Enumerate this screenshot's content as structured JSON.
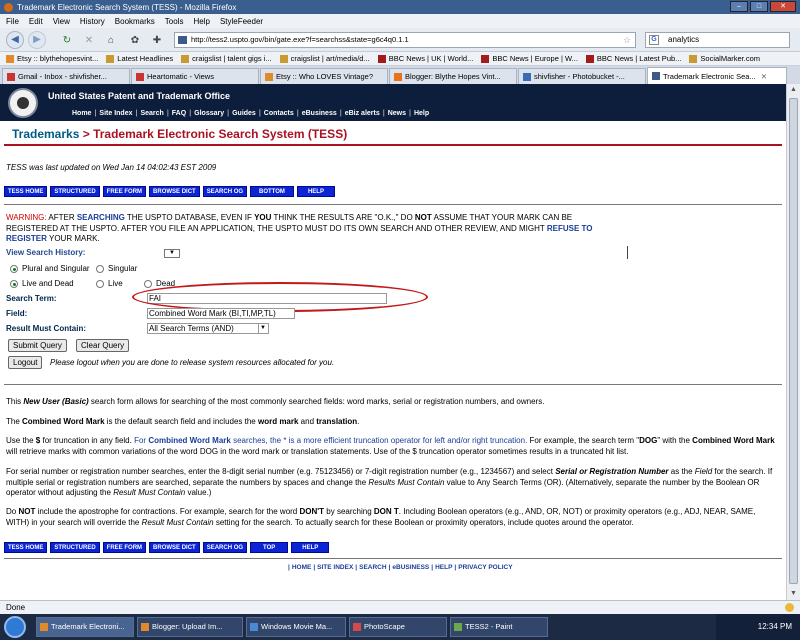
{
  "window": {
    "title": "Trademark Electronic Search System (TESS) - Mozilla Firefox"
  },
  "menu": [
    "File",
    "Edit",
    "View",
    "History",
    "Bookmarks",
    "Tools",
    "Help",
    "StyleFeeder"
  ],
  "nav": {
    "url": "http://tess2.uspto.gov/bin/gate.exe?f=searchss&state=g6c4q0.1.1",
    "search_value": "analytics"
  },
  "bookmarks": [
    "Etsy :: blythehopesvint...",
    "Latest Headlines",
    "craigslist | talent gigs i...",
    "craigslist | art/media/d...",
    "BBC News | UK | World...",
    "BBC News | Europe | W...",
    "BBC News | Latest Pub...",
    "SocialMarker.com"
  ],
  "tabs": [
    "Gmail - Inbox - shivfisher...",
    "Heartomatic - Views",
    "Etsy :: Who LOVES Vintage?",
    "Blogger: Blythe Hopes Vint...",
    "shivfisher - Photobucket -...",
    "Trademark Electronic Sea..."
  ],
  "banner": {
    "title": "United States Patent and Trademark Office",
    "links": [
      "Home",
      "Site Index",
      "Search",
      "FAQ",
      "Glossary",
      "Guides",
      "Contacts",
      "eBusiness",
      "eBiz alerts",
      "News",
      "Help"
    ]
  },
  "heading": {
    "trademarks": "Trademarks",
    "arrow": " > ",
    "rest": "Trademark Electronic Search System (TESS)"
  },
  "updated": "TESS was last updated on Wed Jan 14 04:02:43 EST 2009",
  "nav_buttons_top": [
    "TESS HOME",
    "STRUCTURED",
    "FREE FORM",
    "BROWSE DICT",
    "SEARCH OG",
    "BOTTOM",
    "HELP"
  ],
  "nav_buttons_bottom": [
    "TESS HOME",
    "STRUCTURED",
    "FREE FORM",
    "BROWSE DICT",
    "SEARCH OG",
    "TOP",
    "HELP"
  ],
  "warning": {
    "label": "WARNING:",
    "t1": " AFTER ",
    "searching": "SEARCHING",
    "t2": " THE USPTO DATABASE, EVEN IF ",
    "you": "YOU",
    "t3": " THINK THE RESULTS ARE \"O.K.,\" DO ",
    "not": "NOT",
    "t4": " ASSUME THAT YOUR MARK CAN BE REGISTERED AT THE USPTO. AFTER YOU FILE AN APPLICATION, THE USPTO MUST DO ITS OWN SEARCH AND OTHER REVIEW, AND MIGHT ",
    "refuse": "REFUSE TO REGISTER",
    "t5": " YOUR MARK."
  },
  "form": {
    "history_label": "View Search History:",
    "radio": {
      "plural_singular": "Plural and Singular",
      "singular": "Singular",
      "live_dead": "Live and Dead",
      "live": "Live",
      "dead": "Dead"
    },
    "search_term_label": "Search Term:",
    "search_term_value": "FAI",
    "field_label": "Field:",
    "field_value": "Combined Word Mark (BI,TI,MP,TL)",
    "contain_label": "Result Must Contain:",
    "contain_value": "All Search Terms (AND)",
    "submit": "Submit Query",
    "clear": "Clear Query",
    "logout": "Logout",
    "logout_note": "Please logout when you are done to release system resources allocated for you."
  },
  "help": {
    "p1a": "This ",
    "p1b": "New User (Basic)",
    "p1c": " search form allows for searching of the most commonly searched fields: word marks, serial or registration numbers, and owners.",
    "p2a": "The ",
    "p2b": "Combined Word Mark",
    "p2c": " is the default search field and includes the ",
    "p2d": "word mark",
    "p2e": " and ",
    "p2f": "translation",
    "p2g": ".",
    "p3a": "Use the ",
    "p3b": "$",
    "p3c": " for truncation in any field. ",
    "p3d": "For ",
    "p3e": "Combined Word Mark",
    "p3f": " searches, the * is a more efficient truncation operator for left and/or right truncation.",
    "p3g": " For example, the search term \"",
    "p3h": "DOG",
    "p3i": "\" with the ",
    "p3j": "Combined Word Mark",
    "p3k": " will retrieve marks with common variations of the word DOG in the word mark or translation statements. Use of the $ truncation operator sometimes results in a truncated hit list.",
    "p4a": "For serial number or registration number searches, enter the 8-digit serial number (e.g. 75123456) or 7-digit registration number (e.g., 1234567) and select ",
    "p4b": "Serial or Registration Number",
    "p4c": " as the ",
    "p4d": "Field",
    "p4e": " for the search. If multiple serial or registration numbers are searched, separate the numbers by spaces and change the ",
    "p4f": "Results Must Contain",
    "p4g": " value to Any Search Terms (OR). (Alternatively, separate the number by the Boolean OR operator without adjusting the ",
    "p4h": "Result Must Contain",
    "p4i": " value.)",
    "p5a": "Do ",
    "p5b": "NOT",
    "p5c": " include the apostrophe for contractions. For example, search for the word ",
    "p5d": "DON'T",
    "p5e": " by searching ",
    "p5f": "DON T",
    "p5g": ". Including Boolean operators (e.g., AND, OR, NOT) or proximity operators (e.g., ADJ, NEAR, SAME, WITH) in your search will override the ",
    "p5h": "Result Must Contain",
    "p5i": " setting for the search. To actually search for these Boolean or proximity operators, include quotes around the operator."
  },
  "footer_links": [
    "HOME",
    "SITE INDEX",
    "SEARCH",
    "eBUSINESS",
    "HELP",
    "PRIVACY POLICY"
  ],
  "status": "Done",
  "taskbar": {
    "items": [
      "Trademark Electroni...",
      "Blogger: Upload Im...",
      "Windows Movie Ma...",
      "PhotoScape",
      "TESS2 - Paint"
    ],
    "clock": "12:34 PM"
  }
}
